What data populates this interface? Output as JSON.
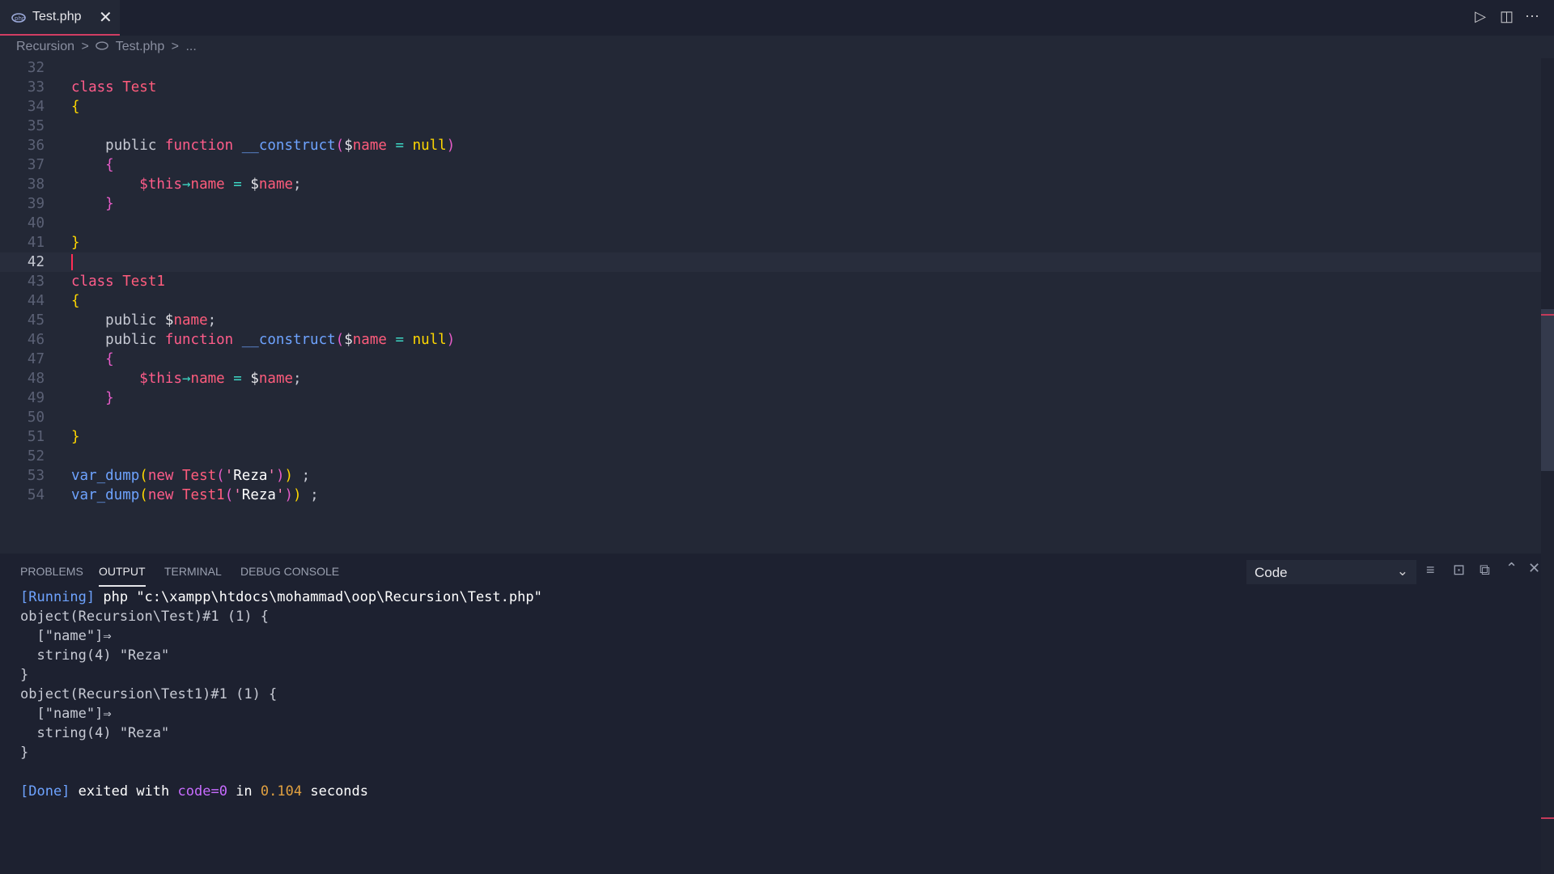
{
  "tab": {
    "label": "Test.php",
    "icon": "php-elephant-icon"
  },
  "breadcrumb": {
    "folder": "Recursion",
    "sep": ">",
    "file": "Test.php",
    "more": "..."
  },
  "editor": {
    "lines": [
      {
        "n": "32"
      },
      {
        "n": "33"
      },
      {
        "n": "34"
      },
      {
        "n": "35"
      },
      {
        "n": "36"
      },
      {
        "n": "37"
      },
      {
        "n": "38"
      },
      {
        "n": "39"
      },
      {
        "n": "40"
      },
      {
        "n": "41"
      },
      {
        "n": "42"
      },
      {
        "n": "43"
      },
      {
        "n": "44"
      },
      {
        "n": "45"
      },
      {
        "n": "46"
      },
      {
        "n": "47"
      },
      {
        "n": "48"
      },
      {
        "n": "49"
      },
      {
        "n": "50"
      },
      {
        "n": "51"
      },
      {
        "n": "52"
      },
      {
        "n": "53"
      },
      {
        "n": "54"
      }
    ],
    "current_line": "42",
    "code": {
      "kw_class": "class",
      "cls_test": "Test",
      "cls_test1": "Test1",
      "open": "{",
      "close": "}",
      "kw_public": "public",
      "kw_function": "function",
      "fn_construct": "__construct",
      "paren_open": "(",
      "paren_close": ")",
      "dollar": "$",
      "var_name": "name",
      "eq": "=",
      "null": "null",
      "this": "$this",
      "arrow": "→",
      "semi": ";",
      "var_dump": "var_dump",
      "kw_new": "new",
      "quote": "'",
      "str_reza": "Reza",
      "space_semi": " ;"
    }
  },
  "panel": {
    "tabs": [
      "PROBLEMS",
      "OUTPUT",
      "TERMINAL",
      "DEBUG CONSOLE"
    ],
    "active_tab": "OUTPUT",
    "channel": "Code"
  },
  "output": {
    "running_tag": "[Running]",
    "running_cmd": "php \"c:\\xampp\\htdocs\\mohammad\\oop\\Recursion\\Test.php\"",
    "obj1_head": "object(Recursion\\Test)#1 (1) {",
    "prop": "  [\"name\"]⇒",
    "val": "  string(4) \"Reza\"",
    "close": "}",
    "obj2_head": "object(Recursion\\Test1)#1 (1) {",
    "done_tag": "[Done]",
    "done_a": "exited with",
    "done_code": "code=0",
    "done_in": "in",
    "done_time": "0.104",
    "done_seconds": "seconds"
  },
  "colors": {
    "accent": "#d13d63",
    "keyword": "#ff5c8a",
    "function": "#6ea3ff",
    "bracket": "#ffd700"
  }
}
